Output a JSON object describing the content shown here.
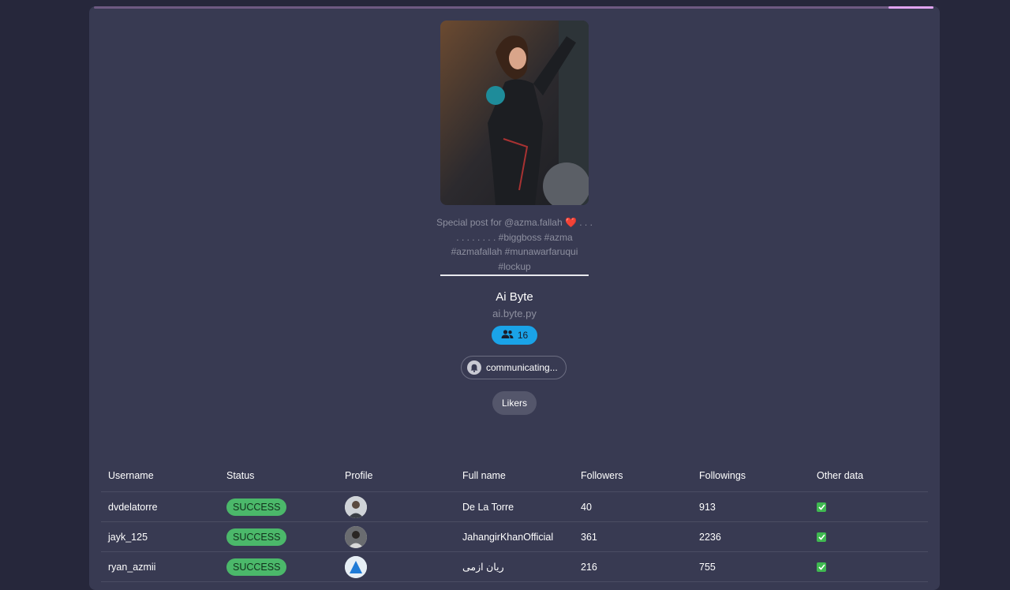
{
  "post": {
    "caption": "Special post for @azma.fallah ❤️ . . . . . . . . . . . #biggboss #azma #azmafallah #munawarfaruqui #lockup"
  },
  "profile": {
    "name": "Ai Byte",
    "handle": "ai.byte.py",
    "followers_count": "16"
  },
  "status_label": "communicating...",
  "likers_label": "Likers",
  "table": {
    "headers": [
      "Username",
      "Status",
      "Profile",
      "Full name",
      "Followers",
      "Followings",
      "Other data"
    ],
    "rows": [
      {
        "username": "dvdelatorre",
        "status": "SUCCESS",
        "full_name": "De La Torre",
        "followers": "40",
        "followings": "913"
      },
      {
        "username": "jayk_125",
        "status": "SUCCESS",
        "full_name": "JahangirKhanOfficial",
        "followers": "361",
        "followings": "2236"
      },
      {
        "username": "ryan_azmii",
        "status": "SUCCESS",
        "full_name": "ریان ازمی",
        "followers": "216",
        "followings": "755"
      }
    ]
  },
  "colors": {
    "background": "#26273b",
    "card": "#383a52",
    "accent_blue": "#1aa3e8",
    "success_green": "#4bb86a"
  }
}
